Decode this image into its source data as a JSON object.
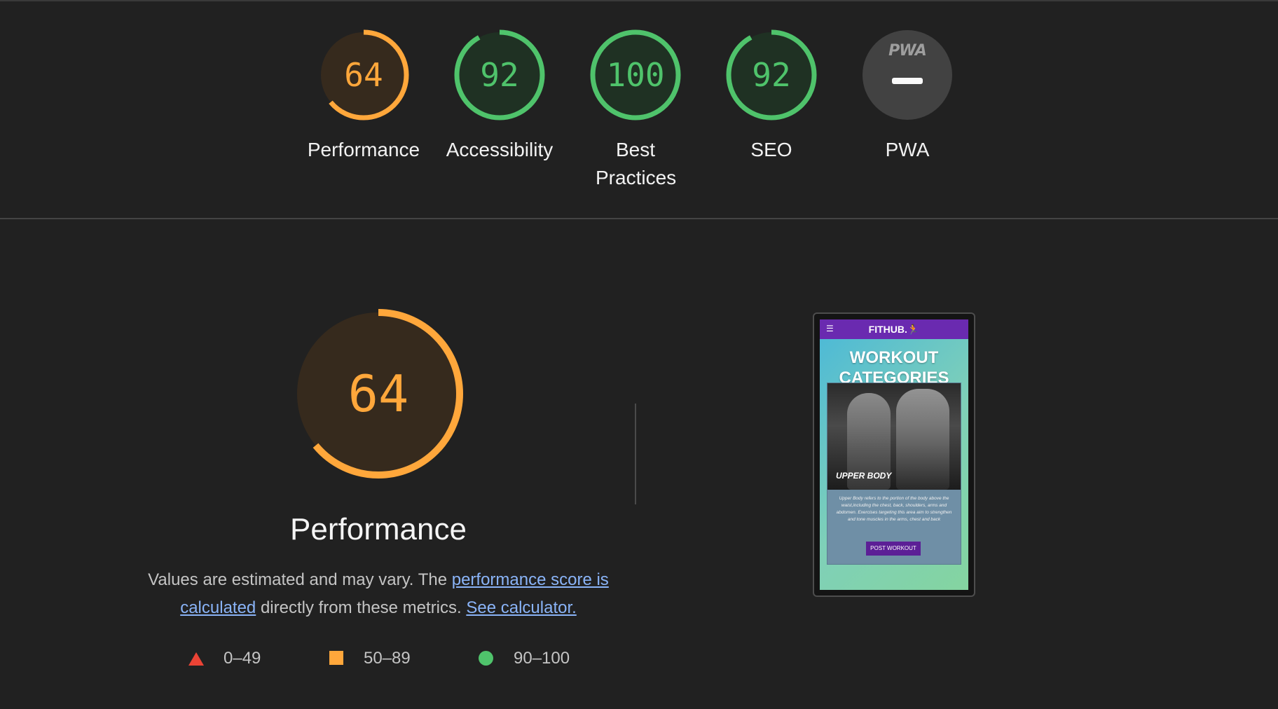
{
  "category_gauges": [
    {
      "label": "Performance",
      "score": "64",
      "value": 64,
      "color": "#ffa73b"
    },
    {
      "label": "Accessibility",
      "score": "92",
      "value": 92,
      "color": "#4fc36b"
    },
    {
      "label": "Best Practices",
      "score": "100",
      "value": 100,
      "color": "#4fc36b"
    },
    {
      "label": "SEO",
      "score": "92",
      "value": 92,
      "color": "#4fc36b"
    },
    {
      "label": "PWA",
      "badge_text": "PWA",
      "color": "#9e9e9e"
    }
  ],
  "performance": {
    "score": "64",
    "value": 64,
    "title": "Performance",
    "desc_prefix": "Values are estimated and may vary. The ",
    "link_score": "performance score is calculated",
    "desc_middle": " directly from these metrics. ",
    "link_calculator": "See calculator.",
    "color": "#ffa73b"
  },
  "legend": [
    {
      "range": "0–49",
      "shape": "triangle",
      "color": "#eb4335"
    },
    {
      "range": "50–89",
      "shape": "square",
      "color": "#ffa73b"
    },
    {
      "range": "90–100",
      "shape": "circle",
      "color": "#4fc36b"
    }
  ],
  "screenshot": {
    "menu_icon": "☰",
    "brand": "FITHUB.",
    "heading_line1": "WORKOUT",
    "heading_line2": "CATEGORIES",
    "card_label": "UPPER BODY",
    "card_text": "Upper Body refers to the portion of the body above the waist,including the chest, back, shoulders, arms and abdomen. Exercises targeting this area aim to strengthen and tone muscles in the arms, chest and back",
    "button": "POST WORKOUT"
  }
}
